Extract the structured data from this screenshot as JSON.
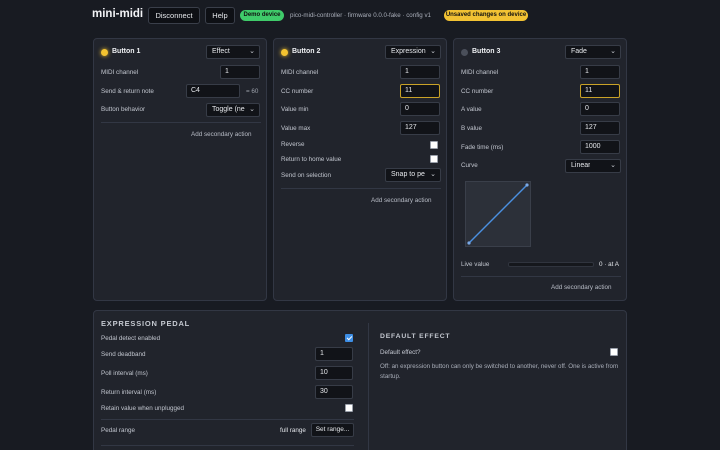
{
  "header": {
    "title": "mini-midi",
    "disconnect_label": "Disconnect",
    "help_label": "Help",
    "demo_badge": "Demo device",
    "meta": "pico-midi-controller · firmware 0.0.0-fake · config v1",
    "unsaved_badge": "Unsaved changes on device"
  },
  "colors": {
    "demo_badge": "#3fcb6a",
    "unsaved_badge": "#f2c233",
    "active_dot": "#f4c430",
    "focus_border": "#c9a227",
    "checkbox_on": "#3d8ee6",
    "curve_line": "#4a90e2"
  },
  "icons": {
    "dropdown": "chevron-down-icon",
    "status": "status-dot-icon",
    "check": "check-icon"
  },
  "button1": {
    "title": "Button 1",
    "mode": "Effect",
    "midi_channel_label": "MIDI channel",
    "midi_channel": "1",
    "send_return_label": "Send & return note",
    "note": "C4",
    "note_number": "= 60",
    "behavior_label": "Button behavior",
    "behavior": "Toggle (nee",
    "secondary_label": "Add secondary action"
  },
  "button2": {
    "title": "Button 2",
    "mode": "Expression",
    "midi_channel_label": "MIDI channel",
    "midi_channel": "1",
    "cc_label": "CC number",
    "cc": "11",
    "value_min_label": "Value min",
    "value_min": "0",
    "value_max_label": "Value max",
    "value_max": "127",
    "reverse_label": "Reverse",
    "return_home_label": "Return to home value",
    "send_on_selection_label": "Send on selection",
    "send_on_selection": "Snap to pe",
    "secondary_label": "Add secondary action"
  },
  "button3": {
    "title": "Button 3",
    "mode": "Fade",
    "midi_channel_label": "MIDI channel",
    "midi_channel": "1",
    "cc_label": "CC number",
    "cc": "11",
    "a_label": "A value",
    "a_value": "0",
    "b_label": "B value",
    "b_value": "127",
    "fade_label": "Fade time (ms)",
    "fade_time": "1000",
    "curve_label": "Curve",
    "curve": "Linear",
    "live_label": "Live value",
    "live_value": "0 · at A",
    "live_fraction": 0,
    "secondary_label": "Add secondary action"
  },
  "expression": {
    "title": "EXPRESSION PEDAL",
    "detect_label": "Pedal detect enabled",
    "detect_checked": true,
    "deadband_label": "Send deadband",
    "deadband": "1",
    "poll_label": "Poll interval (ms)",
    "poll": "10",
    "return_label": "Return interval (ms)",
    "return_interval": "30",
    "retain_label": "Retain value when unplugged",
    "retain_checked": false,
    "range_label": "Pedal range",
    "range_value": "full range",
    "range_button": "Set range..."
  },
  "default_effect": {
    "title": "DEFAULT EFFECT",
    "question_label": "Default effect?",
    "help": "Off: an expression button can only be switched to another, never off. One is active from startup."
  }
}
